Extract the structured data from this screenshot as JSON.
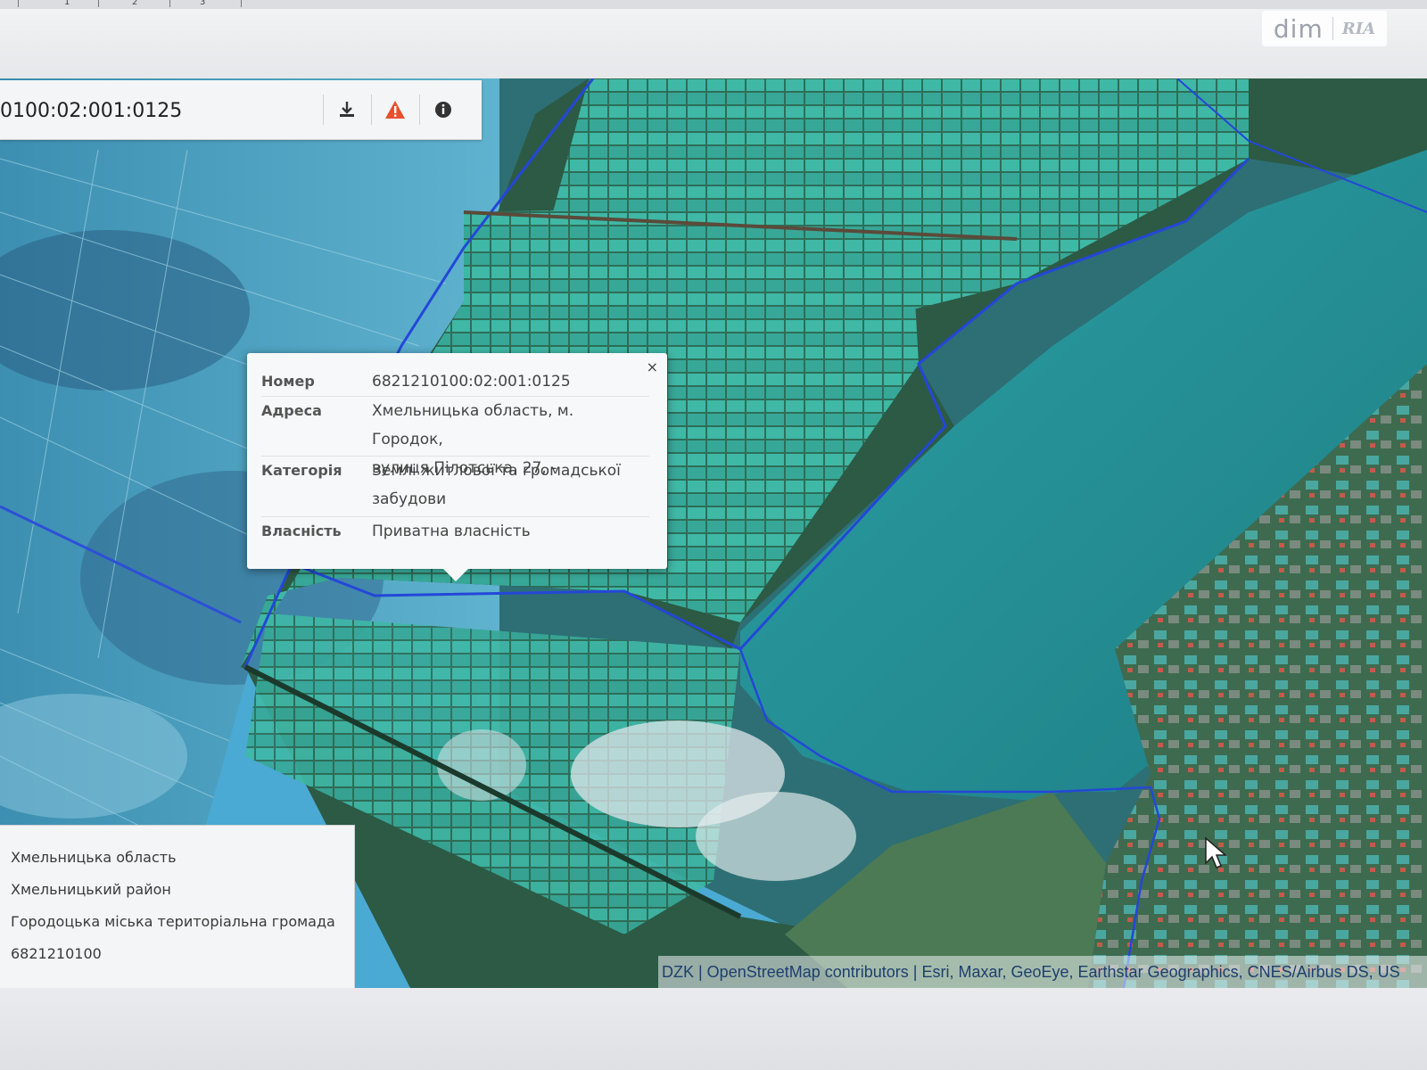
{
  "toolbar": {
    "parcel_id": "0100:02:001:0125",
    "download_icon": "download-icon",
    "warning_icon": "warning-triangle-icon",
    "info_icon": "info-circle-icon",
    "warning_color": "#e8502d"
  },
  "watermark": {
    "text": "dim",
    "brand": "RIA"
  },
  "popup": {
    "close_label": "×",
    "rows": [
      {
        "key": "Номер",
        "value_lines": [
          "6821210100:02:001:0125"
        ]
      },
      {
        "key": "Адреса",
        "value_lines": [
          "Хмельницька область, м. Городок,",
          "вулиця Пілотська, 27, -"
        ]
      },
      {
        "key": "Категорія",
        "value_lines": [
          "Землі житлової та громадської",
          "забудови"
        ]
      },
      {
        "key": "Власність",
        "value_lines": [
          "Приватна власність"
        ]
      }
    ]
  },
  "info_panel": {
    "lines": [
      "Хмельницька область",
      "Хмельницький район",
      "Городоцька міська територіальна громада",
      "6821210100"
    ]
  },
  "attribution": "DZK | OpenStreetMap contributors | Esri, Maxar, GeoEye, Earthstar Geographics, CNES/Airbus DS, US",
  "ruler": {
    "numbers": [
      "1",
      "2",
      "3"
    ]
  },
  "map_colors": {
    "lake": "#2a8c8f",
    "parcel_fill": "#3fc3b0",
    "boundary": "#2447d8",
    "field": "#3a6e52"
  }
}
